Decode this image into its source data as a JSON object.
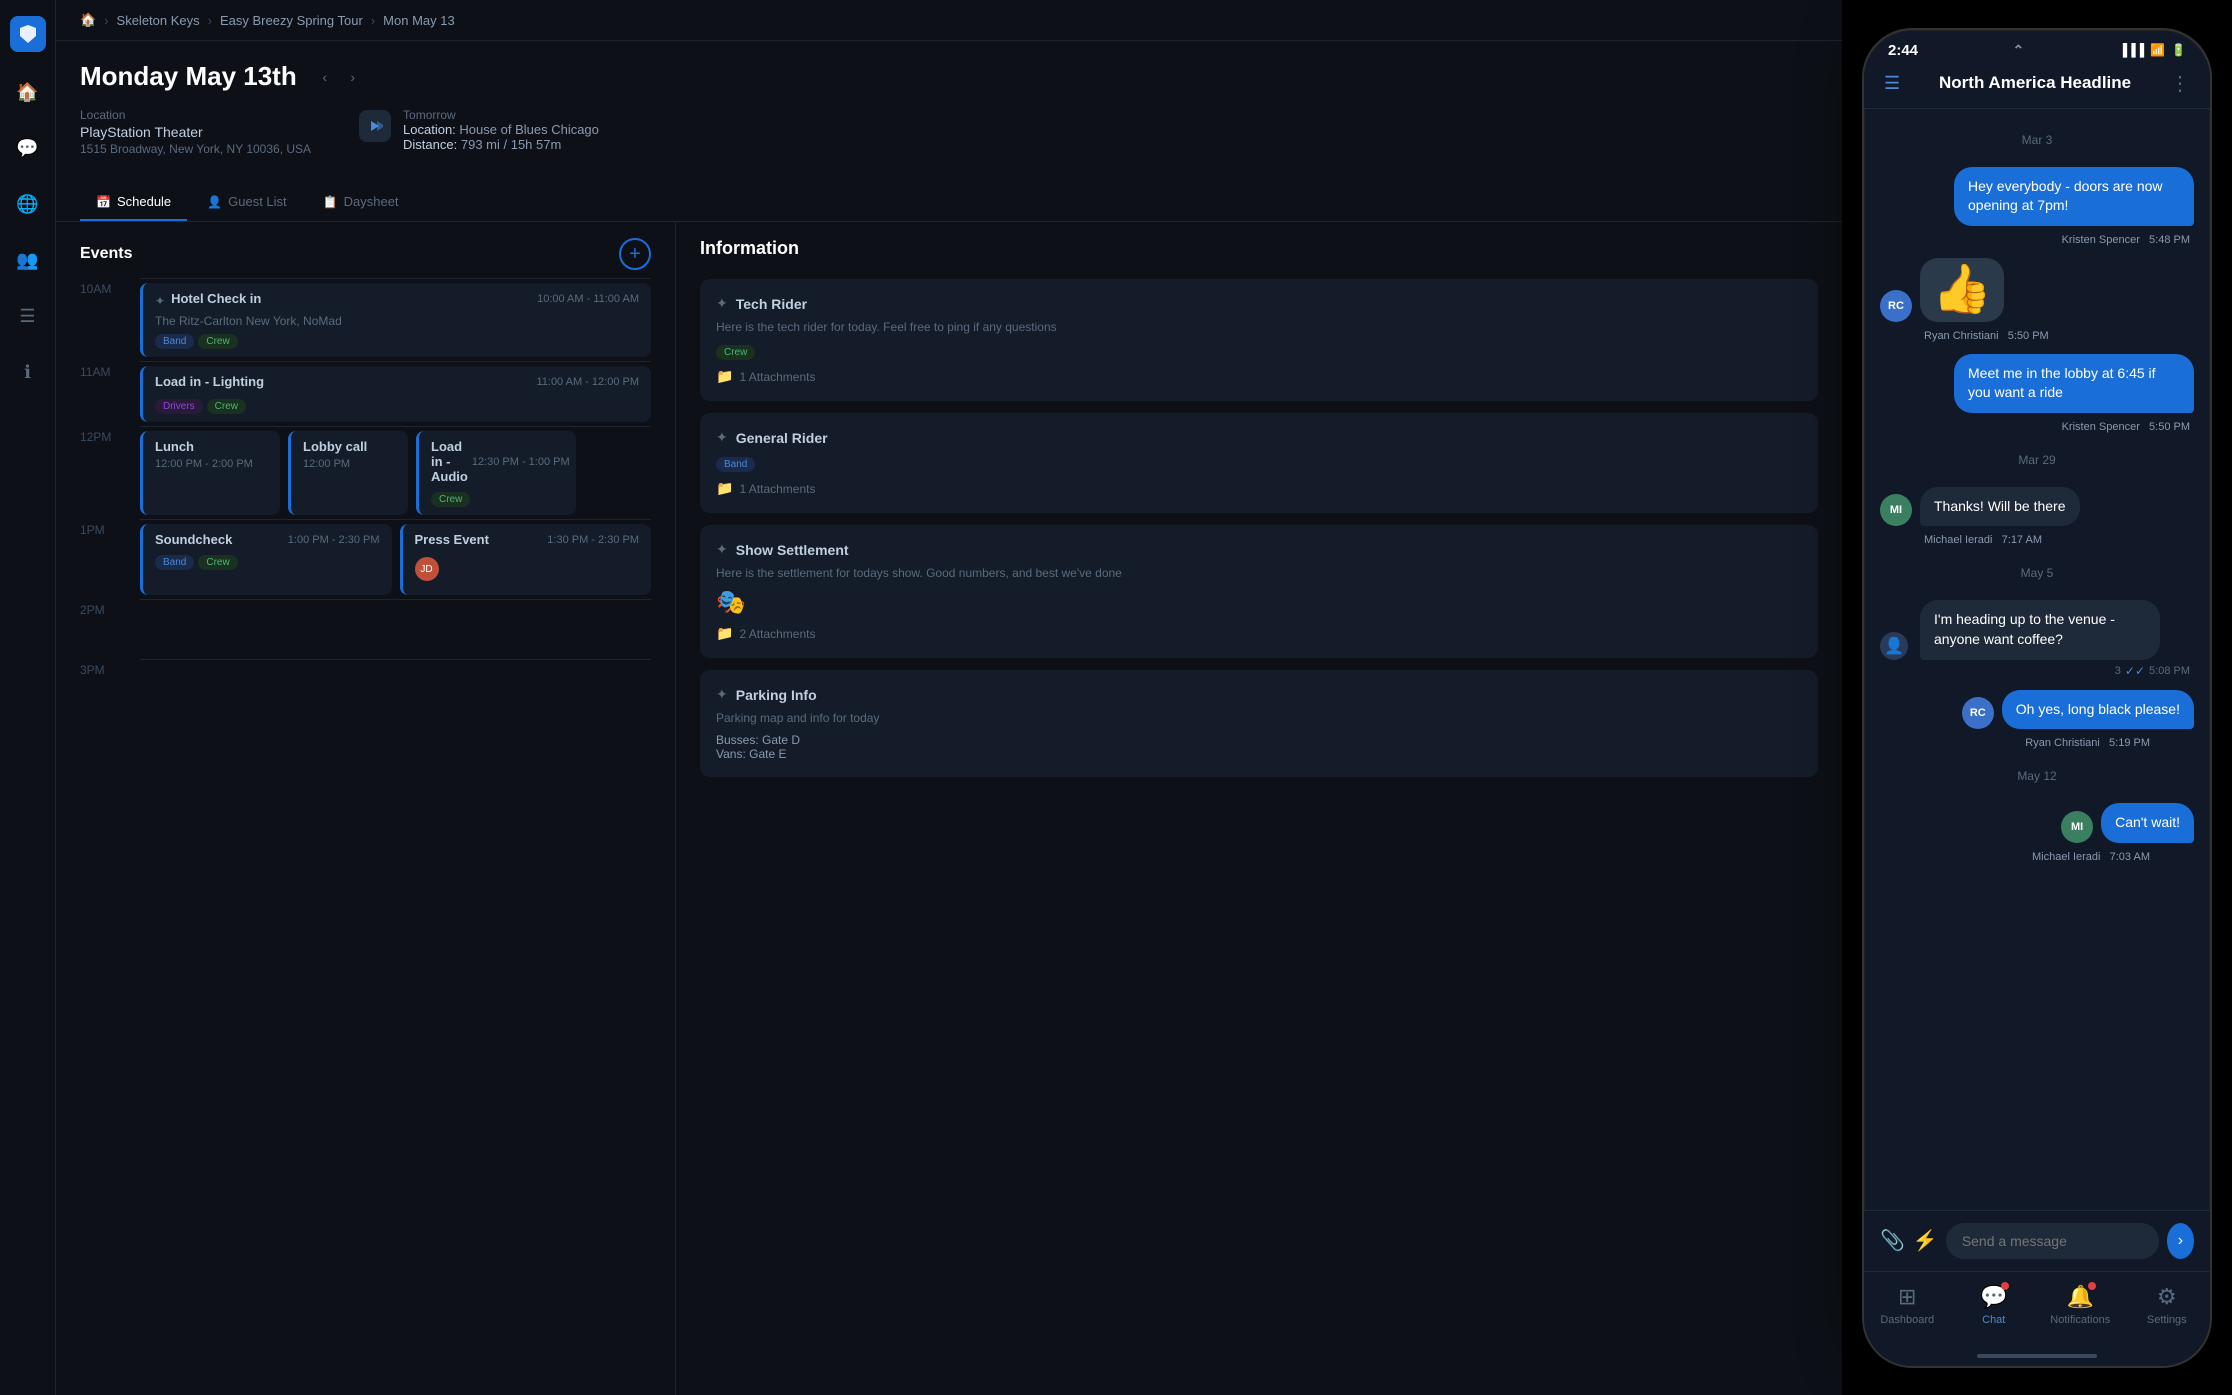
{
  "app": {
    "breadcrumb": {
      "home_icon": "🏠",
      "item1": "Skeleton Keys",
      "item2": "Easy Breezy Spring Tour",
      "item3": "Mon May 13"
    },
    "page_title": "Monday May 13th",
    "location": {
      "label": "Location",
      "venue": "PlayStation Theater",
      "address": "1515 Broadway, New York, NY 10036, USA"
    },
    "tomorrow": {
      "label": "Tomorrow",
      "location_label": "Location:",
      "location_value": "House of Blues Chicago",
      "distance_label": "Distance:",
      "distance_value": "793 mi / 15h 57m"
    },
    "tabs": [
      {
        "id": "schedule",
        "label": "Schedule",
        "active": true
      },
      {
        "id": "guestlist",
        "label": "Guest List",
        "active": false
      },
      {
        "id": "daysheet",
        "label": "Daysheet",
        "active": false
      }
    ],
    "events_title": "Events",
    "schedule": [
      {
        "time_label": "10AM",
        "events": [
          {
            "title": "Hotel Check in",
            "time": "10:00 AM - 11:00 AM",
            "venue": "The Ritz-Carlton New York, NoMad",
            "tags": [
              "Band",
              "Crew"
            ]
          }
        ]
      },
      {
        "time_label": "11AM",
        "events": [
          {
            "title": "Load in - Lighting",
            "time": "11:00 AM - 12:00 PM",
            "tags": [
              "Drivers",
              "Crew"
            ]
          }
        ]
      },
      {
        "time_label": "12PM",
        "events": [
          {
            "title": "Lunch",
            "time": "12:00 PM - 2:00 PM",
            "tags": []
          },
          {
            "title": "Lobby call",
            "time": "12:00 PM",
            "tags": []
          },
          {
            "title": "Load in - Audio",
            "time": "12:30 PM - 1:00 PM",
            "tags": [
              "Crew"
            ]
          }
        ]
      },
      {
        "time_label": "1PM",
        "events": [
          {
            "title": "Soundcheck",
            "time": "1:00 PM - 2:30 PM",
            "tags": [
              "Band",
              "Crew"
            ]
          },
          {
            "title": "Press Event",
            "time": "1:30 PM - 2:30 PM",
            "tags": []
          }
        ]
      },
      {
        "time_label": "2PM",
        "events": []
      },
      {
        "time_label": "3PM",
        "events": []
      }
    ],
    "info_title": "Information",
    "info_cards": [
      {
        "title": "Tech Rider",
        "subtitle": "Here is the tech rider for today. Feel free to ping if any questions",
        "tags": [
          "Crew"
        ],
        "attachments": "1 Attachments"
      },
      {
        "title": "General Rider",
        "subtitle": "",
        "tags": [
          "Band"
        ],
        "attachments": "1 Attachments"
      },
      {
        "title": "Show Settlement",
        "subtitle": "Here is the settlement for todays show. Good numbers, and best we've done",
        "tags": [],
        "attachments": "2 Attachments"
      },
      {
        "title": "Parking Info",
        "subtitle": "Parking map and info for today",
        "tags": [],
        "attachments": null,
        "extra": [
          "Busses: Gate D",
          "Vans: Gate E"
        ]
      }
    ]
  },
  "phone": {
    "status_time": "2:44",
    "chat_title": "North America Headline",
    "messages": [
      {
        "type": "date",
        "text": "Mar 3"
      },
      {
        "type": "bubble",
        "direction": "sent",
        "sender": "",
        "avatar_initials": "",
        "avatar_class": "",
        "text": "Hey everybody - doors are now opening at 7pm!",
        "meta": "Kristen Spencer  5:48 PM"
      },
      {
        "type": "bubble",
        "direction": "received",
        "sender": "RC",
        "avatar_class": "avatar-rc",
        "text": "👍",
        "is_thumb": true,
        "meta": "Ryan Christiani  5:50 PM"
      },
      {
        "type": "bubble",
        "direction": "sent",
        "text": "Meet me in the lobby at 6:45 if you want a ride",
        "meta": "Kristen Spencer  5:50 PM"
      },
      {
        "type": "date",
        "text": "Mar 29"
      },
      {
        "type": "bubble",
        "direction": "received",
        "sender": "MI",
        "avatar_class": "avatar-mi",
        "text": "Thanks! Will be there",
        "meta": "Michael Ieradi  7:17 AM"
      },
      {
        "type": "date",
        "text": "May 5"
      },
      {
        "type": "bubble",
        "direction": "received",
        "sender": "",
        "avatar_class": "",
        "text": "I'm heading up to the venue - anyone want coffee?",
        "meta": "3 ✓✓ 5:08 PM",
        "floating": true
      },
      {
        "type": "bubble",
        "direction": "sent",
        "text": "Oh yes, long black please!",
        "meta": "Ryan Christiani  5:19 PM",
        "sender_initials": "RC",
        "avatar_class": "avatar-rc"
      },
      {
        "type": "date",
        "text": "May 12"
      },
      {
        "type": "bubble",
        "direction": "sent",
        "text": "Can't wait!",
        "meta": "Michael Ieradi  7:03 AM",
        "sender_initials": "MI",
        "avatar_class": "avatar-mi"
      }
    ],
    "input_placeholder": "Send a message",
    "nav_items": [
      {
        "id": "dashboard",
        "label": "Dashboard",
        "icon": "⊞",
        "active": false,
        "badge": false
      },
      {
        "id": "chat",
        "label": "Chat",
        "icon": "💬",
        "active": true,
        "badge": true
      },
      {
        "id": "notifications",
        "label": "Notifications",
        "icon": "🔔",
        "active": false,
        "badge": true
      },
      {
        "id": "settings",
        "label": "Settings",
        "icon": "⚙",
        "active": false,
        "badge": false
      }
    ]
  }
}
